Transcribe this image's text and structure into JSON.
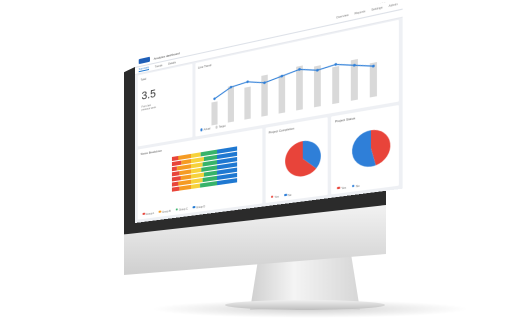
{
  "app": {
    "title": "Analytics dashboard",
    "nav": [
      "Overview",
      "Reports",
      "Settings",
      "Admin"
    ],
    "tabs": [
      "Summary",
      "Trends",
      "Details"
    ]
  },
  "kpi": {
    "label": "Total",
    "value": "3.5",
    "sub1": "From last",
    "sub2": "previous week"
  },
  "line_chart": {
    "title": "Line Trend",
    "legend": [
      "Actual",
      "Target"
    ],
    "colors": {
      "line": "#2f7fd8",
      "bar": "#d9d9d9"
    }
  },
  "stacked_bars": {
    "title": "Status Breakdown",
    "colors": [
      "#e8443a",
      "#f59b23",
      "#f6d23b",
      "#37b36a",
      "#1f78d1"
    ],
    "legend": [
      "Group A",
      "Group B",
      "Group C",
      "Group D"
    ]
  },
  "pie1": {
    "title": "Project Completion",
    "colors": {
      "a": "#e8443a",
      "b": "#2f7fd8"
    },
    "legend": [
      "Yes",
      "No"
    ]
  },
  "pie2": {
    "title": "Project Status",
    "colors": {
      "a": "#e8443a",
      "b": "#2f7fd8"
    },
    "legend": [
      "Yes",
      "No"
    ]
  }
}
